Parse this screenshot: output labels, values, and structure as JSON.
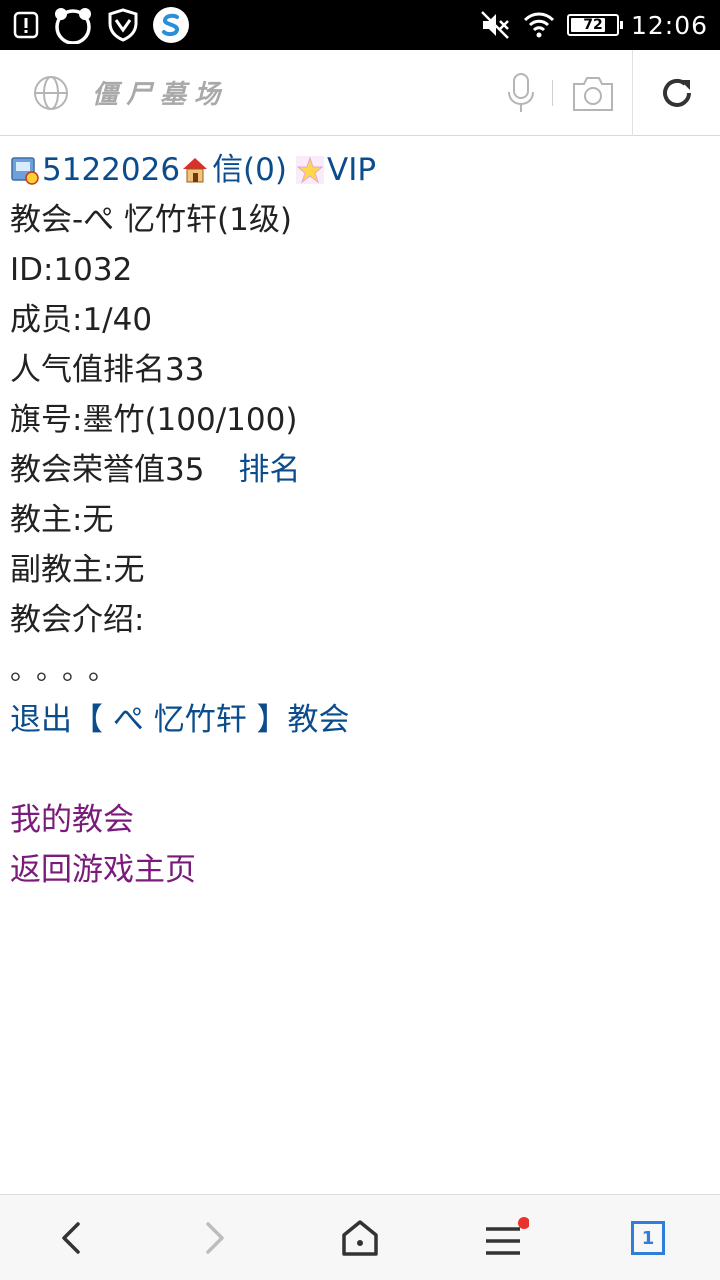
{
  "status_bar": {
    "time": "12:06",
    "battery_level": "72",
    "left_icons": [
      "alert-icon",
      "panda-app-icon",
      "shield-icon",
      "sogou-app-icon"
    ],
    "right_icons": [
      "mute-icon",
      "wifi-icon",
      "battery-icon"
    ]
  },
  "address_bar": {
    "page_title": "僵尸墓场",
    "icons": [
      "globe-icon",
      "microphone-icon",
      "camera-icon",
      "reload-icon"
    ]
  },
  "content": {
    "user_id": "5122026",
    "mail_link": "信(0)",
    "vip_link": "VIP",
    "church_title": "教会-ぺ 忆竹轩(1级)",
    "church_id": "ID:1032",
    "members": "成员:1/40",
    "popularity_rank": "人气值排名33",
    "flag": "旗号:墨竹(100/100)",
    "honor": "教会荣誉值35",
    "rank_link": "排名",
    "leader": "教主:无",
    "vice_leader": "副教主:无",
    "intro_label": "教会介绍:",
    "intro_text": "。。。。",
    "quit_link": "退出【 ぺ 忆竹轩 】教会",
    "my_church_link": "我的教会",
    "home_link": "返回游戏主页"
  },
  "bottom_bar": {
    "tab_count": "1",
    "icons": [
      "back-icon",
      "forward-icon",
      "home-icon",
      "menu-icon",
      "tabs-icon"
    ]
  },
  "colors": {
    "link": "#0b4c8c",
    "visited_link": "#7a1a7a",
    "text": "#222222",
    "accent_blue": "#2f7ed8",
    "notification_red": "#e8322e"
  }
}
